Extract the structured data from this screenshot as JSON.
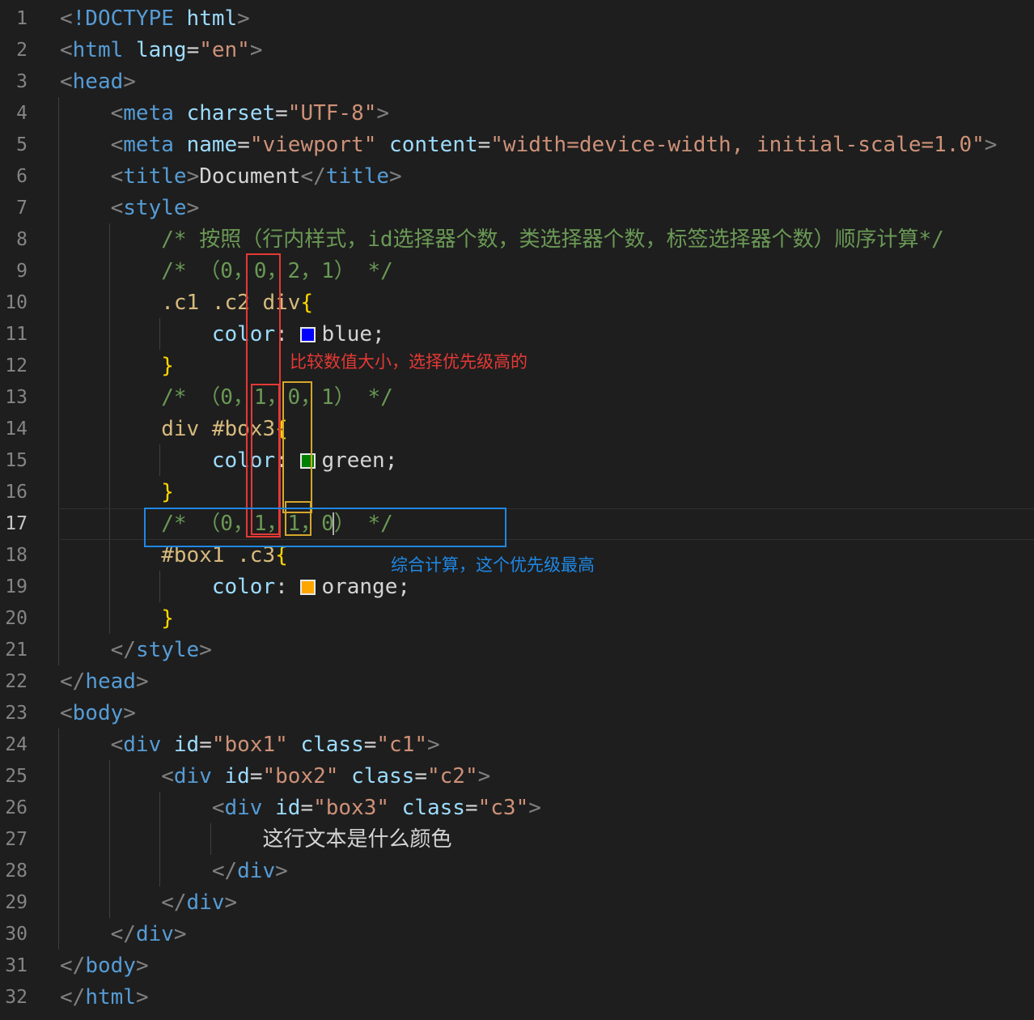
{
  "editor": {
    "active_line": 17,
    "lines": [
      {
        "n": 1,
        "tokens": [
          [
            "grey",
            "<"
          ],
          [
            "tag",
            "!DOCTYPE"
          ],
          [
            "text",
            " "
          ],
          [
            "attr",
            "html"
          ],
          [
            "grey",
            ">"
          ]
        ]
      },
      {
        "n": 2,
        "tokens": [
          [
            "grey",
            "<"
          ],
          [
            "tag",
            "html"
          ],
          [
            "text",
            " "
          ],
          [
            "attr",
            "lang"
          ],
          [
            "text",
            "="
          ],
          [
            "str",
            "\"en\""
          ],
          [
            "grey",
            ">"
          ]
        ]
      },
      {
        "n": 3,
        "tokens": [
          [
            "grey",
            "<"
          ],
          [
            "tag",
            "head"
          ],
          [
            "grey",
            ">"
          ]
        ]
      },
      {
        "n": 4,
        "tokens": [
          [
            "text",
            "    "
          ],
          [
            "grey",
            "<"
          ],
          [
            "tag",
            "meta"
          ],
          [
            "text",
            " "
          ],
          [
            "attr",
            "charset"
          ],
          [
            "text",
            "="
          ],
          [
            "str",
            "\"UTF-8\""
          ],
          [
            "grey",
            ">"
          ]
        ]
      },
      {
        "n": 5,
        "tokens": [
          [
            "text",
            "    "
          ],
          [
            "grey",
            "<"
          ],
          [
            "tag",
            "meta"
          ],
          [
            "text",
            " "
          ],
          [
            "attr",
            "name"
          ],
          [
            "text",
            "="
          ],
          [
            "str",
            "\"viewport\""
          ],
          [
            "text",
            " "
          ],
          [
            "attr",
            "content"
          ],
          [
            "text",
            "="
          ],
          [
            "str",
            "\"width=device-width, initial-scale=1.0\""
          ],
          [
            "grey",
            ">"
          ]
        ]
      },
      {
        "n": 6,
        "tokens": [
          [
            "text",
            "    "
          ],
          [
            "grey",
            "<"
          ],
          [
            "tag",
            "title"
          ],
          [
            "grey",
            ">"
          ],
          [
            "text",
            "Document"
          ],
          [
            "grey",
            "</"
          ],
          [
            "tag",
            "title"
          ],
          [
            "grey",
            ">"
          ]
        ]
      },
      {
        "n": 7,
        "tokens": [
          [
            "text",
            "    "
          ],
          [
            "grey",
            "<"
          ],
          [
            "tag",
            "style"
          ],
          [
            "grey",
            ">"
          ]
        ]
      },
      {
        "n": 8,
        "tokens": [
          [
            "text",
            "        "
          ],
          [
            "com",
            "/* 按照（行内样式，id选择器个数，类选择器个数，标签选择器个数）顺序计算*/"
          ]
        ]
      },
      {
        "n": 9,
        "tokens": [
          [
            "text",
            "        "
          ],
          [
            "com",
            "/* （0，0，2，1） */"
          ]
        ]
      },
      {
        "n": 10,
        "tokens": [
          [
            "text",
            "        "
          ],
          [
            "sel",
            ".c1 .c2 div"
          ],
          [
            "brace",
            "{"
          ]
        ]
      },
      {
        "n": 11,
        "tokens": [
          [
            "text",
            "            "
          ],
          [
            "attr",
            "color"
          ],
          [
            "text",
            ": "
          ],
          [
            "swatch",
            "#0000ff"
          ],
          [
            "text",
            "blue;"
          ]
        ]
      },
      {
        "n": 12,
        "tokens": [
          [
            "text",
            "        "
          ],
          [
            "brace",
            "}"
          ]
        ]
      },
      {
        "n": 13,
        "tokens": [
          [
            "text",
            "        "
          ],
          [
            "com",
            "/* （0，1，0，1） */"
          ]
        ]
      },
      {
        "n": 14,
        "tokens": [
          [
            "text",
            "        "
          ],
          [
            "sel",
            "div #box3"
          ],
          [
            "brace",
            "{"
          ]
        ]
      },
      {
        "n": 15,
        "tokens": [
          [
            "text",
            "            "
          ],
          [
            "attr",
            "color"
          ],
          [
            "text",
            ": "
          ],
          [
            "swatch",
            "#008000"
          ],
          [
            "text",
            "green;"
          ]
        ]
      },
      {
        "n": 16,
        "tokens": [
          [
            "text",
            "        "
          ],
          [
            "brace",
            "}"
          ]
        ]
      },
      {
        "n": 17,
        "tokens": [
          [
            "text",
            "        "
          ],
          [
            "com",
            "/* （0，1，1，0"
          ],
          [
            "cursor",
            ""
          ],
          [
            "com",
            "） */"
          ]
        ]
      },
      {
        "n": 18,
        "tokens": [
          [
            "text",
            "        "
          ],
          [
            "sel",
            "#box1 .c3"
          ],
          [
            "brace",
            "{"
          ]
        ]
      },
      {
        "n": 19,
        "tokens": [
          [
            "text",
            "            "
          ],
          [
            "attr",
            "color"
          ],
          [
            "text",
            ": "
          ],
          [
            "swatch",
            "#ffa500"
          ],
          [
            "text",
            "orange;"
          ]
        ]
      },
      {
        "n": 20,
        "tokens": [
          [
            "text",
            "        "
          ],
          [
            "brace",
            "}"
          ]
        ]
      },
      {
        "n": 21,
        "tokens": [
          [
            "text",
            "    "
          ],
          [
            "grey",
            "</"
          ],
          [
            "tag",
            "style"
          ],
          [
            "grey",
            ">"
          ]
        ]
      },
      {
        "n": 22,
        "tokens": [
          [
            "grey",
            "</"
          ],
          [
            "tag",
            "head"
          ],
          [
            "grey",
            ">"
          ]
        ]
      },
      {
        "n": 23,
        "tokens": [
          [
            "grey",
            "<"
          ],
          [
            "tag",
            "body"
          ],
          [
            "grey",
            ">"
          ]
        ]
      },
      {
        "n": 24,
        "tokens": [
          [
            "text",
            "    "
          ],
          [
            "grey",
            "<"
          ],
          [
            "tag",
            "div"
          ],
          [
            "text",
            " "
          ],
          [
            "attr",
            "id"
          ],
          [
            "text",
            "="
          ],
          [
            "str",
            "\"box1\""
          ],
          [
            "text",
            " "
          ],
          [
            "attr",
            "class"
          ],
          [
            "text",
            "="
          ],
          [
            "str",
            "\"c1\""
          ],
          [
            "grey",
            ">"
          ]
        ]
      },
      {
        "n": 25,
        "tokens": [
          [
            "text",
            "        "
          ],
          [
            "grey",
            "<"
          ],
          [
            "tag",
            "div"
          ],
          [
            "text",
            " "
          ],
          [
            "attr",
            "id"
          ],
          [
            "text",
            "="
          ],
          [
            "str",
            "\"box2\""
          ],
          [
            "text",
            " "
          ],
          [
            "attr",
            "class"
          ],
          [
            "text",
            "="
          ],
          [
            "str",
            "\"c2\""
          ],
          [
            "grey",
            ">"
          ]
        ]
      },
      {
        "n": 26,
        "tokens": [
          [
            "text",
            "            "
          ],
          [
            "grey",
            "<"
          ],
          [
            "tag",
            "div"
          ],
          [
            "text",
            " "
          ],
          [
            "attr",
            "id"
          ],
          [
            "text",
            "="
          ],
          [
            "str",
            "\"box3\""
          ],
          [
            "text",
            " "
          ],
          [
            "attr",
            "class"
          ],
          [
            "text",
            "="
          ],
          [
            "str",
            "\"c3\""
          ],
          [
            "grey",
            ">"
          ]
        ]
      },
      {
        "n": 27,
        "tokens": [
          [
            "text",
            "                这行文本是什么颜色"
          ]
        ]
      },
      {
        "n": 28,
        "tokens": [
          [
            "text",
            "            "
          ],
          [
            "grey",
            "</"
          ],
          [
            "tag",
            "div"
          ],
          [
            "grey",
            ">"
          ]
        ]
      },
      {
        "n": 29,
        "tokens": [
          [
            "text",
            "        "
          ],
          [
            "grey",
            "</"
          ],
          [
            "tag",
            "div"
          ],
          [
            "grey",
            ">"
          ]
        ]
      },
      {
        "n": 30,
        "tokens": [
          [
            "text",
            "    "
          ],
          [
            "grey",
            "</"
          ],
          [
            "tag",
            "div"
          ],
          [
            "grey",
            ">"
          ]
        ]
      },
      {
        "n": 31,
        "tokens": [
          [
            "grey",
            "</"
          ],
          [
            "tag",
            "body"
          ],
          [
            "grey",
            ">"
          ]
        ]
      },
      {
        "n": 32,
        "tokens": [
          [
            "grey",
            "</"
          ],
          [
            "tag",
            "html"
          ],
          [
            "grey",
            ">"
          ]
        ]
      }
    ]
  },
  "annotations": {
    "note_compare": "比较数值大小，选择优先级高的",
    "note_total": "综合计算，这个优先级最高",
    "colors": {
      "red": "#e53935",
      "yellow": "#d4a72c",
      "blue": "#1e88e5"
    }
  }
}
